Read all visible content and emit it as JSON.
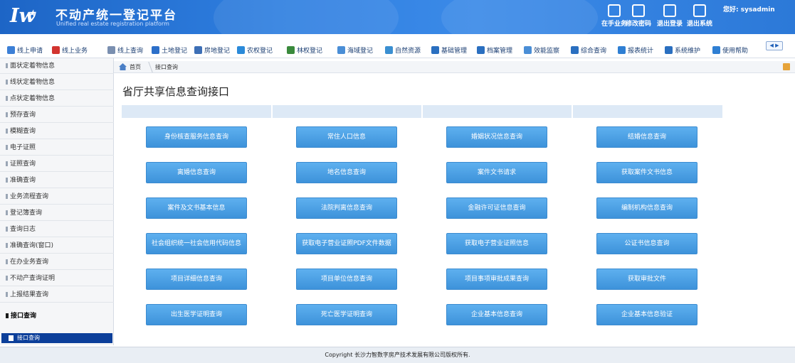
{
  "header": {
    "logo_text": "Iw",
    "brand_cn": "不动产统一登记平台",
    "brand_en": "Unified real estate registration platform",
    "greeting": "您好: sysadmin",
    "actions": [
      {
        "icon": "user-tasks-icon",
        "label": "在手业务"
      },
      {
        "icon": "edit-password-icon",
        "label": "修改密码"
      },
      {
        "icon": "logout-icon",
        "label": "退出登录"
      },
      {
        "icon": "exit-system-icon",
        "label": "退出系统"
      }
    ]
  },
  "nav": {
    "items": [
      {
        "icon": "online-apply-icon",
        "color": "#3c7fd6",
        "label": "线上申请"
      },
      {
        "icon": "online-business-icon",
        "color": "#d2342f",
        "label": "线上业务"
      },
      {
        "icon": "online-query-icon",
        "color": "#7a8fb0",
        "label": "线上查询"
      },
      {
        "icon": "land-register-icon",
        "color": "#2c6fc9",
        "label": "土地登记"
      },
      {
        "icon": "house-register-icon",
        "color": "#3d6fb6",
        "label": "房地登记"
      },
      {
        "icon": "farm-register-icon",
        "color": "#2b8ad9",
        "label": "农权登记"
      },
      {
        "icon": "forest-register-icon",
        "color": "#3a8a3c",
        "label": "林权登记"
      },
      {
        "icon": "sea-register-icon",
        "color": "#4a8ed6",
        "label": "海域登记"
      },
      {
        "icon": "natural-resource-icon",
        "color": "#3a8fd1",
        "label": "自然资源"
      },
      {
        "icon": "base-manage-icon",
        "color": "#2a6fc0",
        "label": "基础管理"
      },
      {
        "icon": "archive-manage-icon",
        "color": "#2a6fc0",
        "label": "档案管理"
      },
      {
        "icon": "efficiency-monitor-icon",
        "color": "#4a8ed6",
        "label": "效能监察"
      },
      {
        "icon": "comprehensive-query-icon",
        "color": "#2a6fc0",
        "label": "综合查询"
      },
      {
        "icon": "report-stat-icon",
        "color": "#2f7fd3",
        "label": "报表统计"
      },
      {
        "icon": "system-maintain-icon",
        "color": "#2a6fc0",
        "label": "系统维护"
      },
      {
        "icon": "help-icon",
        "color": "#2f7fd3",
        "label": "使用帮助"
      }
    ],
    "arrows": "◀ ▶"
  },
  "sidebar": {
    "items": [
      {
        "label": "面状定着物信息",
        "active": false
      },
      {
        "label": "线状定着物信息",
        "active": false
      },
      {
        "label": "点状定着物信息",
        "active": false
      },
      {
        "label": "预存查询",
        "active": false
      },
      {
        "label": "模糊查询",
        "active": false
      },
      {
        "label": "电子证照",
        "active": false
      },
      {
        "label": "证照查询",
        "active": false
      },
      {
        "label": "准确查询",
        "active": false
      },
      {
        "label": "业务流程查询",
        "active": false
      },
      {
        "label": "登记簿查询",
        "active": false
      },
      {
        "label": "查询日志",
        "active": false
      },
      {
        "label": "准确查询(窗口)",
        "active": false
      },
      {
        "label": "在办业务查询",
        "active": false
      },
      {
        "label": "不动产查询证明",
        "active": false
      },
      {
        "label": "上报结果查询",
        "active": false
      },
      {
        "label": "接口查询",
        "active": true
      }
    ],
    "sub_item": "接口查询"
  },
  "breadcrumb": {
    "home": "首页",
    "current": "接口查询"
  },
  "page_title": "省厅共享信息查询接口",
  "buttons": [
    [
      "身份核查服务信息查询",
      "常住人口信息",
      "婚姻状况信息查询",
      "结婚信息查询"
    ],
    [
      "离婚信息查询",
      "地名信息查询",
      "案件文书请求",
      "获取案件文书信息"
    ],
    [
      "案件及文书基本信息",
      "法院判离信息查询",
      "金融许可证信息查询",
      "编制机构信息查询"
    ],
    [
      "社会组织统一社会信用代码信息",
      "获取电子营业证照PDF文件数据",
      "获取电子营业证照信息",
      "公证书信息查询"
    ],
    [
      "项目详细信息查询",
      "项目单位信息查询",
      "项目事项审批成果查询",
      "获取审批文件"
    ],
    [
      "出生医学证明查询",
      "死亡医学证明查询",
      "企业基本信息查询",
      "企业基本信息验证"
    ]
  ],
  "footer": "Copyright 长沙力智数字房产技术发展有限公司版权所有."
}
